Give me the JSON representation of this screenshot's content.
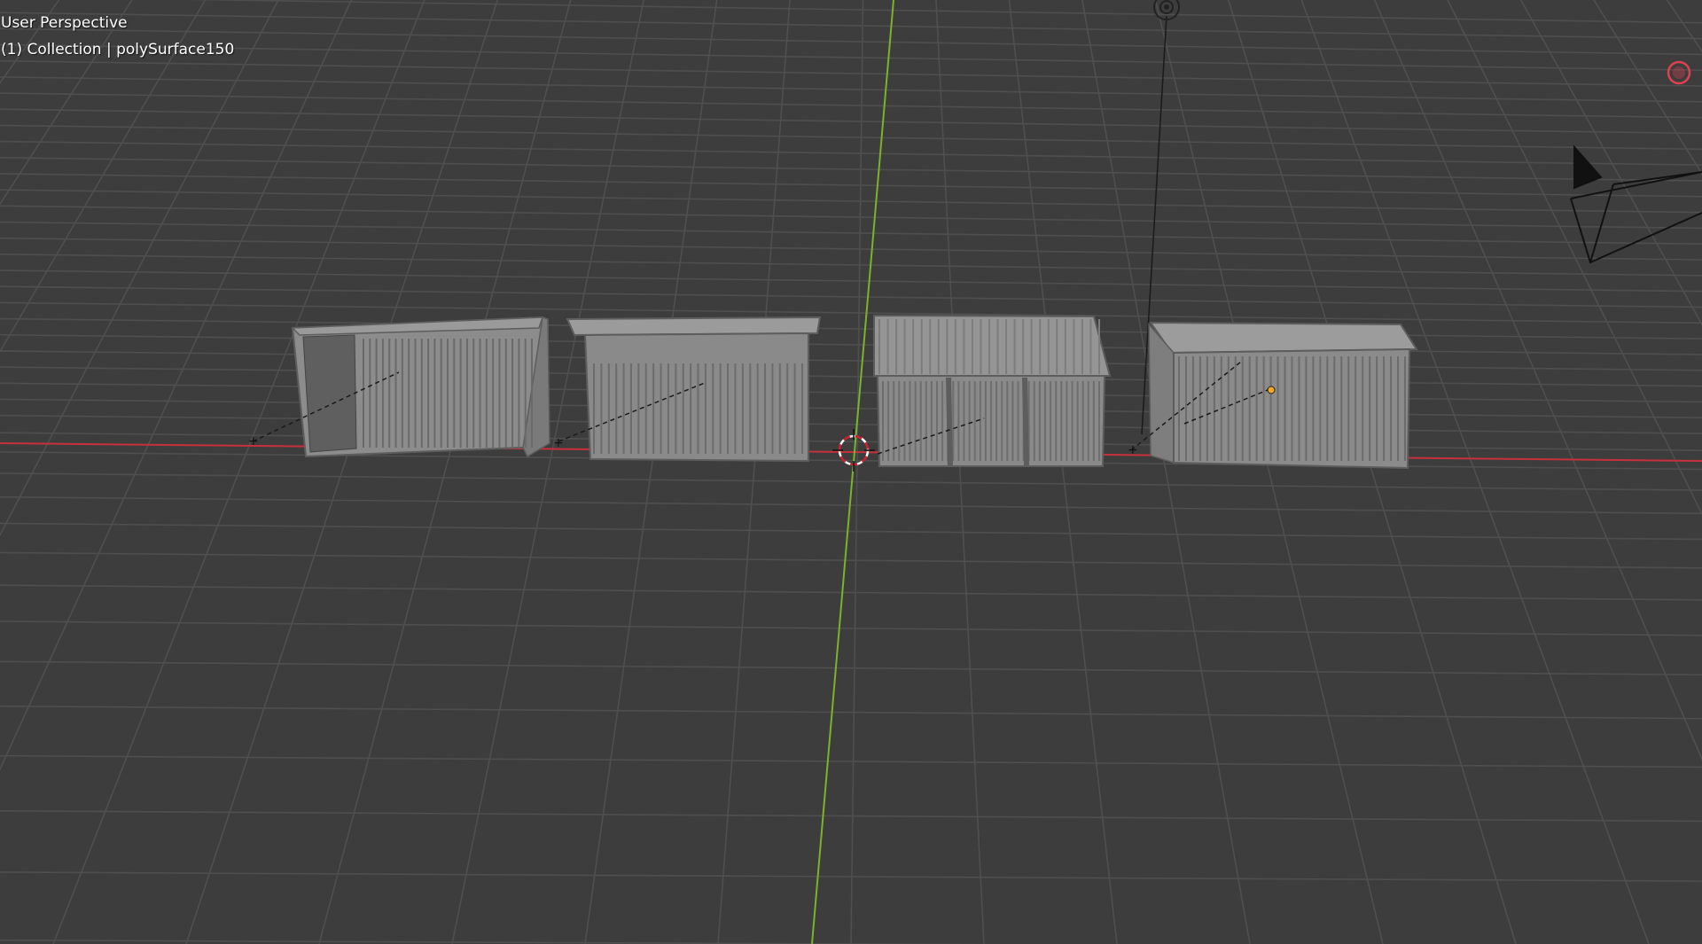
{
  "viewport": {
    "view_name": "User Perspective",
    "collection_info": "(1) Collection | polySurface150"
  },
  "colors": {
    "background": "#3d3d3d",
    "grid": "#4f4f4f",
    "x_axis": "#c8303c",
    "y_axis": "#7ab32c",
    "mesh_fill": "#8c8c8c",
    "mesh_dark": "#6e6e6e",
    "selected_origin": "#f5a623",
    "record_indicator": "#e04050"
  },
  "icons": {
    "cursor": "3d-cursor-icon",
    "light": "light-icon",
    "camera": "camera-icon",
    "record": "record-icon"
  }
}
